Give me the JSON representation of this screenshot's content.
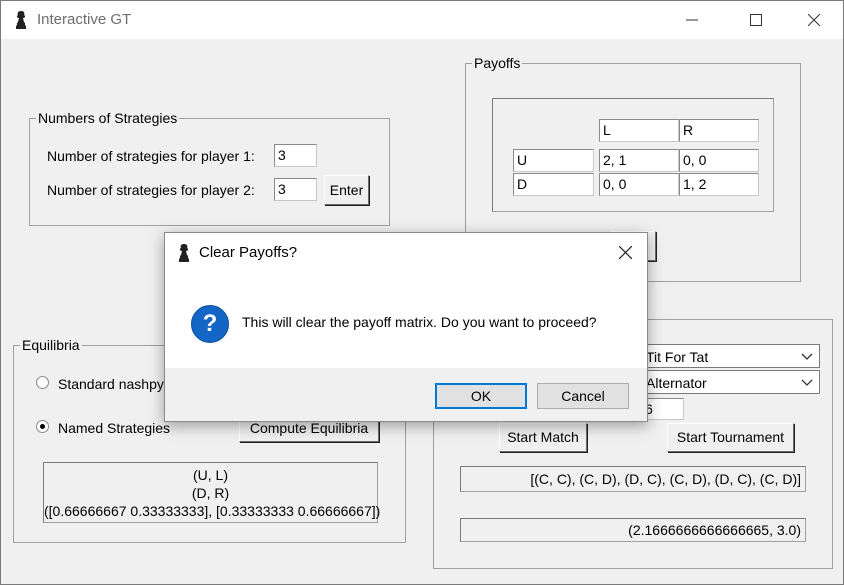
{
  "window": {
    "title": "Interactive GT"
  },
  "strategies": {
    "group_label": "Numbers of Strategies",
    "p1_label": "Number of strategies for player 1:",
    "p1_value": "3",
    "p2_label": "Number of strategies for player 2:",
    "p2_value": "3",
    "enter_label": "Enter"
  },
  "payoffs": {
    "group_label": "Payoffs",
    "col_headers": [
      "L",
      "R"
    ],
    "rows": [
      {
        "label": "U",
        "cells": [
          "2, 1",
          "0, 0"
        ]
      },
      {
        "label": "D",
        "cells": [
          "0, 0",
          "1, 2"
        ]
      }
    ]
  },
  "equilibria": {
    "group_label": "Equilibria",
    "radio1_label": "Standard nashpy",
    "radio2_label": "Named Strategies",
    "selected": "Named Strategies",
    "compute_label": "Compute Equilibria",
    "results": [
      "(U, L)",
      "(D, R)",
      "([0.66666667 0.33333333], [0.33333333 0.66666667])"
    ]
  },
  "match": {
    "strategy1": "Tit For Tat",
    "strategy2": "Alternator",
    "turns_value": "6",
    "start_match_label": "Start Match",
    "start_tournament_label": "Start Tournament",
    "history": "[(C, C), (C, D), (D, C), (C, D), (D, C), (C, D)]",
    "scores": "(2.1666666666666665, 3.0)"
  },
  "dialog": {
    "title": "Clear Payoffs?",
    "message": "This will clear the payoff matrix. Do you want to proceed?",
    "ok_label": "OK",
    "cancel_label": "Cancel",
    "icon": "question-icon",
    "accent": "#0078d7",
    "icon_color": "#1366c6"
  }
}
